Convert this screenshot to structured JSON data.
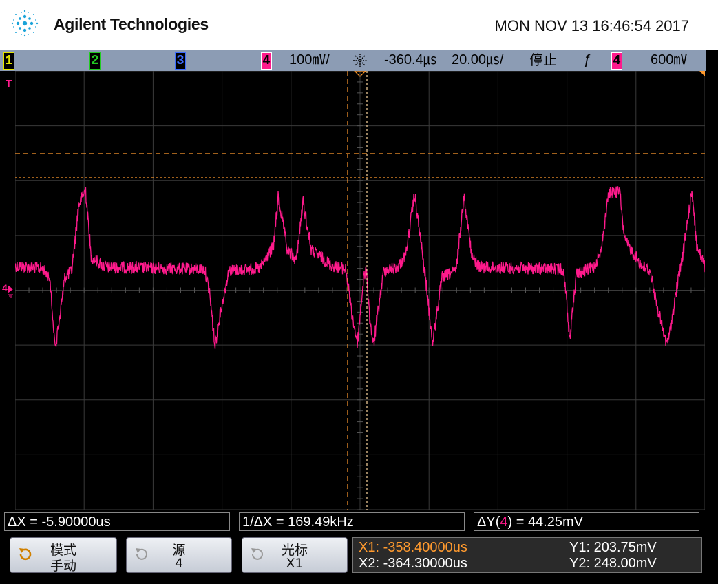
{
  "header": {
    "brand": "Agilent Technologies",
    "timestamp": "MON NOV 13 16:46:54 2017"
  },
  "status_bar": {
    "channels": [
      {
        "label": "1",
        "color": "#e6e600"
      },
      {
        "label": "2",
        "color": "#22cc22"
      },
      {
        "label": "3",
        "color": "#3d6cff"
      },
      {
        "label": "4",
        "color": "#ff1a8c"
      }
    ],
    "vertical_scale": "100㎷/",
    "time_offset": "-360.4㎲",
    "time_scale": "20.00㎲/",
    "run_state": "停止",
    "trigger_slope": "ƒ",
    "trigger_channel": "4",
    "trigger_level": "600㎷"
  },
  "screen": {
    "trigger_marker": "T",
    "channel4_marker": "4",
    "trace_color": "#ff1a8c",
    "cursor_color": "#ff9a2e"
  },
  "readouts": {
    "delta_x": "ΔX = -5.90000us",
    "inv_delta_x": "1/ΔX = 169.49kHz",
    "delta_y_prefix": "ΔY(",
    "delta_y_channel": "4",
    "delta_y_suffix": ") = 44.25mV"
  },
  "softkeys": [
    {
      "line1": "模式",
      "line2": "手动"
    },
    {
      "line1": "源",
      "line2": "4"
    },
    {
      "line1": "光标",
      "line2": "X1"
    }
  ],
  "cursors": {
    "x1": "X1: -358.40000us",
    "x2": "X2: -364.30000us",
    "y1": "Y1: 203.75mV",
    "y2": "Y2: 248.00mV"
  }
}
